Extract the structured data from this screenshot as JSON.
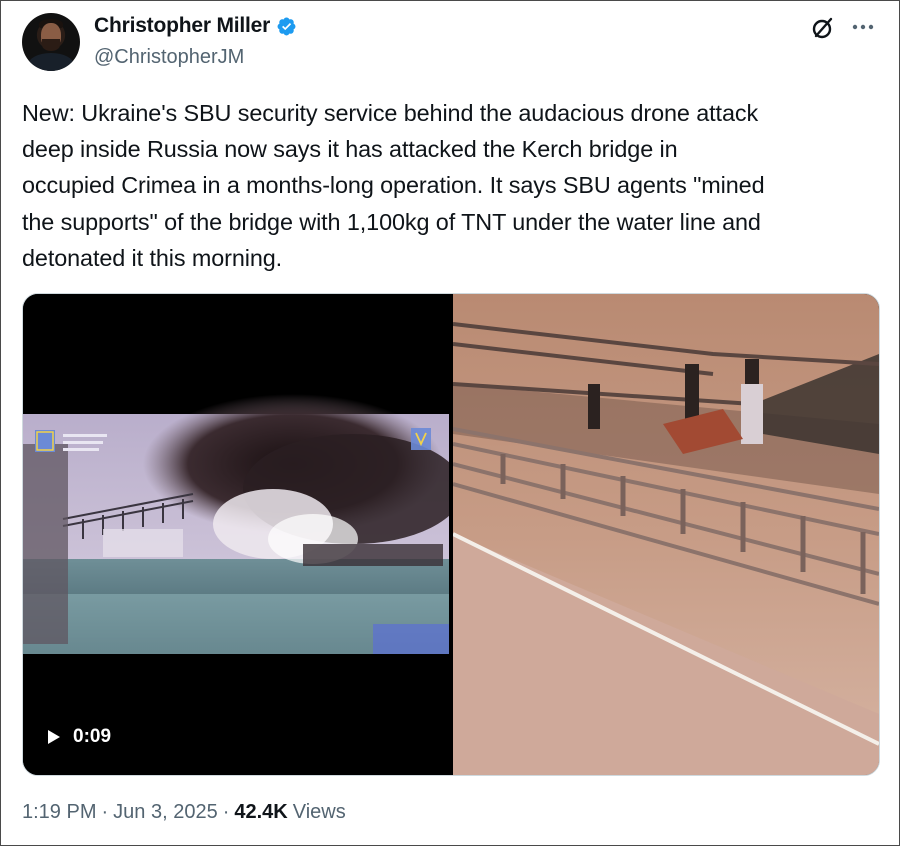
{
  "author": {
    "display_name": "Christopher Miller",
    "handle": "@ChristopherJM",
    "verified_color": "#1d9bf0"
  },
  "header_icons": {
    "grok": "grok-icon",
    "more": "more-horizontal-icon"
  },
  "tweet": {
    "text": "New: Ukraine's SBU security service behind the audacious drone attack\ndeep inside Russia now says it has attacked the Kerch bridge in\noccupied Crimea in a months-long operation. It says SBU agents \"mined\nthe supports\" of the bridge with 1,100kg of TNT under the water line and\ndetonated it this morning."
  },
  "media": {
    "video_duration": "0:09",
    "play_icon": "play-icon"
  },
  "meta": {
    "time": "1:19 PM",
    "date": "Jun 3, 2025",
    "separator": "·",
    "views_count": "42.4K",
    "views_label": "Views"
  }
}
